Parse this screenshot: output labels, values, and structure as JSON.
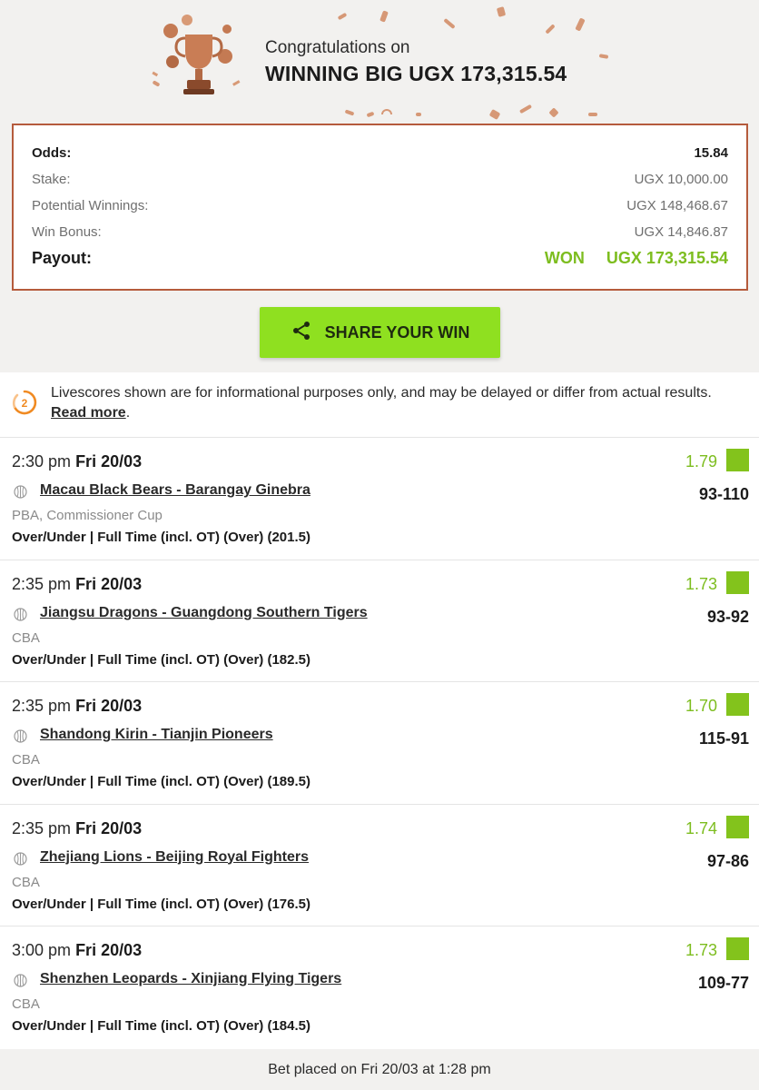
{
  "banner": {
    "congrats": "Congratulations on",
    "win_title": "WINNING BIG UGX 173,315.54"
  },
  "summary": {
    "odds_label": "Odds:",
    "odds_value": "15.84",
    "stake_label": "Stake:",
    "stake_value": "UGX 10,000.00",
    "potential_label": "Potential Winnings:",
    "potential_value": "UGX 148,468.67",
    "bonus_label": "Win Bonus:",
    "bonus_value": "UGX 14,846.87",
    "payout_label": "Payout:",
    "payout_status": "WON",
    "payout_value": "UGX 173,315.54"
  },
  "share": {
    "label": "SHARE YOUR WIN",
    "icon": "share-icon"
  },
  "notice": {
    "text": "Livescores shown are for informational purposes only, and may be delayed or differ from actual results. ",
    "link": "Read more",
    "end": ".",
    "icon": "livescore-icon"
  },
  "legs": [
    {
      "time": "2:30 pm",
      "date": "Fri 20/03",
      "odds": "1.79",
      "match": "Macau Black Bears - Barangay Ginebra",
      "score": "93-110",
      "league": "PBA, Commissioner Cup",
      "market": "Over/Under | Full Time (incl. OT) (Over) (201.5)"
    },
    {
      "time": "2:35 pm",
      "date": "Fri 20/03",
      "odds": "1.73",
      "match": "Jiangsu Dragons - Guangdong Southern Tigers",
      "score": "93-92",
      "league": "CBA",
      "market": "Over/Under | Full Time (incl. OT) (Over) (182.5)"
    },
    {
      "time": "2:35 pm",
      "date": "Fri 20/03",
      "odds": "1.70",
      "match": "Shandong Kirin - Tianjin Pioneers",
      "score": "115-91",
      "league": "CBA",
      "market": "Over/Under | Full Time (incl. OT) (Over) (189.5)"
    },
    {
      "time": "2:35 pm",
      "date": "Fri 20/03",
      "odds": "1.74",
      "match": "Zhejiang Lions - Beijing Royal Fighters",
      "score": "97-86",
      "league": "CBA",
      "market": "Over/Under | Full Time (incl. OT) (Over) (176.5)"
    },
    {
      "time": "3:00 pm",
      "date": "Fri 20/03",
      "odds": "1.73",
      "match": "Shenzhen Leopards - Xinjiang Flying Tigers",
      "score": "109-77",
      "league": "CBA",
      "market": "Over/Under | Full Time (incl. OT) (Over) (184.5)"
    }
  ],
  "footer": {
    "placed": "Bet placed on Fri 20/03 at 1:28 pm"
  },
  "colors": {
    "accent_green": "#7dbd1f",
    "button_green": "#8fe020",
    "border_copper": "#b55b3c"
  }
}
